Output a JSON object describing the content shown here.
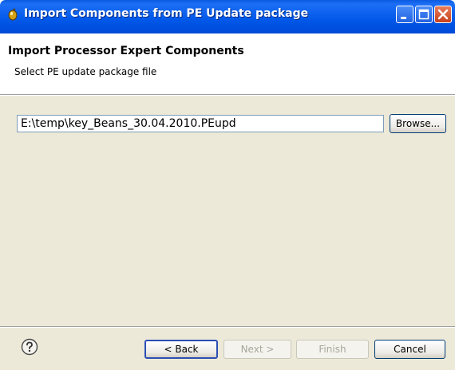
{
  "window": {
    "title": "Import Components from PE Update package"
  },
  "header": {
    "title": "Import Processor Expert Components",
    "subtitle": "Select PE update package file"
  },
  "form": {
    "file_path": "E:\\temp\\key_Beans_30.04.2010.PEupd",
    "browse_label": "Browse..."
  },
  "footer": {
    "back_label": "< Back",
    "next_label": "Next >",
    "finish_label": "Finish",
    "cancel_label": "Cancel"
  },
  "colors": {
    "titlebar": "#0057e8",
    "dialog_bg": "#ece9d8",
    "input_border": "#7f9db9",
    "disabled_text": "#a9a69b"
  },
  "icons": {
    "app": "processor-expert-bean-icon",
    "help": "help-question-icon"
  }
}
